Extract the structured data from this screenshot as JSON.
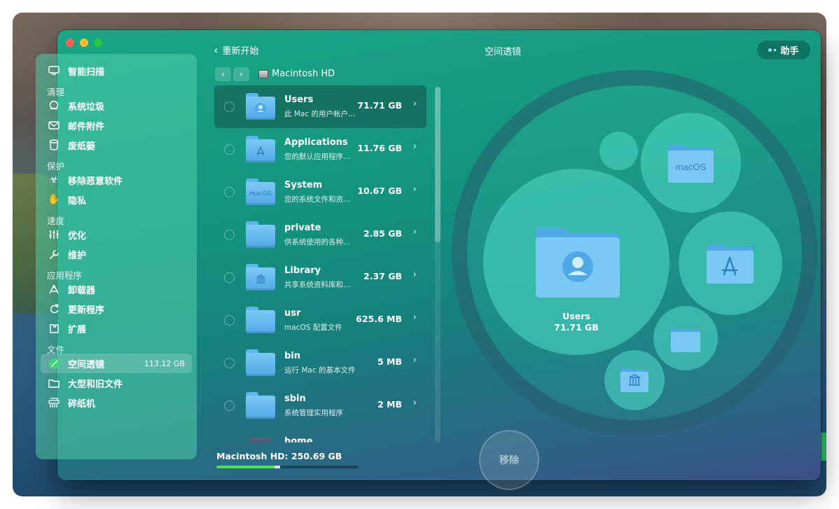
{
  "window": {
    "title": "空间透镜",
    "back_label": "重新开始",
    "assistant_label": "助手"
  },
  "sidebar": {
    "top_item": {
      "label": "智能扫描",
      "icon": "monitor-icon"
    },
    "sections": [
      {
        "title": "清理",
        "items": [
          {
            "label": "系统垃圾",
            "icon": "globe-hand-icon"
          },
          {
            "label": "邮件附件",
            "icon": "envelope-icon"
          },
          {
            "label": "废纸篓",
            "icon": "trash-icon"
          }
        ]
      },
      {
        "title": "保护",
        "items": [
          {
            "label": "移除恶意软件",
            "icon": "biohazard-icon"
          },
          {
            "label": "隐私",
            "icon": "hand-icon"
          }
        ]
      },
      {
        "title": "速度",
        "items": [
          {
            "label": "优化",
            "icon": "sliders-icon"
          },
          {
            "label": "维护",
            "icon": "wrench-icon"
          }
        ]
      },
      {
        "title": "应用程序",
        "items": [
          {
            "label": "卸载器",
            "icon": "uninstall-icon"
          },
          {
            "label": "更新程序",
            "icon": "update-icon"
          },
          {
            "label": "扩展",
            "icon": "extension-icon"
          }
        ]
      },
      {
        "title": "文件",
        "items": [
          {
            "label": "空间透镜",
            "icon": "space-lens-icon",
            "size": "113.12 GB",
            "active": true
          },
          {
            "label": "大型和旧文件",
            "icon": "folder-icon"
          },
          {
            "label": "碎纸机",
            "icon": "shredder-icon"
          }
        ]
      }
    ]
  },
  "browser": {
    "crumb": "Macintosh HD",
    "items": [
      {
        "name": "Users",
        "desc": "此 Mac 的用户帐户…",
        "size": "71.71 GB",
        "glyph": "user",
        "selected": true
      },
      {
        "name": "Applications",
        "desc": "您的默认应用程序…",
        "size": "11.76 GB",
        "glyph": "apps"
      },
      {
        "name": "System",
        "desc": "您的系统文件和资…",
        "size": "10.67 GB",
        "glyph": "macOS"
      },
      {
        "name": "private",
        "desc": "供系统使用的各种…",
        "size": "2.85 GB",
        "glyph": ""
      },
      {
        "name": "Library",
        "desc": "共享系统资料库和…",
        "size": "2.37 GB",
        "glyph": "library"
      },
      {
        "name": "usr",
        "desc": "macOS 配置文件",
        "size": "625.6 MB",
        "glyph": ""
      },
      {
        "name": "bin",
        "desc": "运行 Mac 的基本文件",
        "size": "5 MB",
        "glyph": ""
      },
      {
        "name": "sbin",
        "desc": "系统管理实用程序",
        "size": "2 MB",
        "glyph": ""
      },
      {
        "name": "home",
        "desc": "",
        "size": "",
        "glyph": "server"
      }
    ]
  },
  "storage": {
    "label": "Macintosh HD: 250.69 GB",
    "used_fraction": 0.45,
    "selected_fraction": 0.41
  },
  "remove_label": "移除",
  "bubbles": {
    "users_name": "Users",
    "users_size": "71.71 GB",
    "system_glyph": "macOS"
  },
  "colors": {
    "accent_green": "#52e04a",
    "folder_blue": "#4fa9e6",
    "bubble": "#4edcc8"
  }
}
